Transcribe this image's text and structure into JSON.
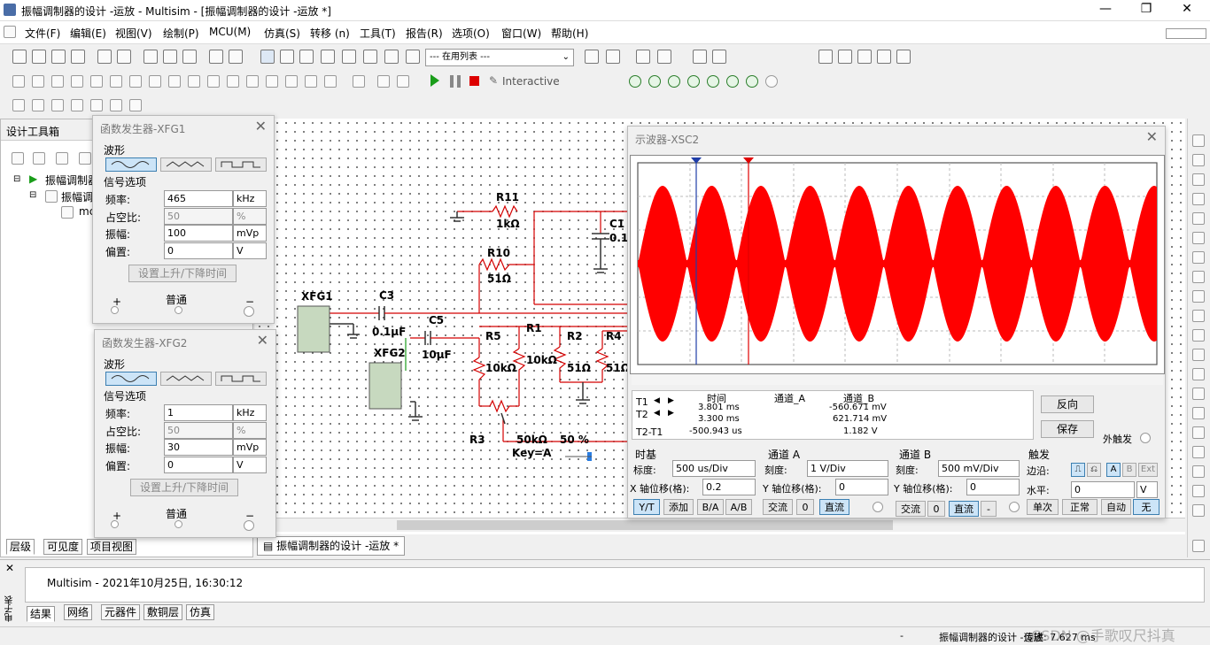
{
  "window": {
    "title": "振幅调制器的设计 -运放 - Multisim - [振幅调制器的设计 -运放 *]",
    "min": "—",
    "max": "❐",
    "close": "✕"
  },
  "menu": [
    "文件(F)",
    "编辑(E)",
    "视图(V)",
    "绘制(P)",
    "MCU(M)",
    "仿真(S)",
    "转移 (n)",
    "工具(T)",
    "报告(R)",
    "选项(O)",
    "窗口(W)",
    "帮助(H)"
  ],
  "toolbar": {
    "in_use_list": "--- 在用列表 ---",
    "interactive": "Interactive"
  },
  "design_toolbox": {
    "title": "设计工具箱",
    "tree": [
      "振幅调制器",
      "振幅调",
      "mc"
    ],
    "tabs": [
      "层级",
      "可见度",
      "项目视图"
    ]
  },
  "xfg1": {
    "title": "函数发生器-XFG1",
    "waveform_label": "波形",
    "signal_label": "信号选项",
    "freq_label": "频率:",
    "freq": "465",
    "freq_unit": "kHz",
    "duty_label": "占空比:",
    "duty": "50",
    "duty_unit": "%",
    "amp_label": "振幅:",
    "amp": "100",
    "amp_unit": "mVp",
    "offset_label": "偏置:",
    "offset": "0",
    "offset_unit": "V",
    "rise_btn": "设置上升/下降时间",
    "plus": "+",
    "common": "普通",
    "minus": "−"
  },
  "xfg2": {
    "title": "函数发生器-XFG2",
    "waveform_label": "波形",
    "signal_label": "信号选项",
    "freq_label": "频率:",
    "freq": "1",
    "freq_unit": "kHz",
    "duty_label": "占空比:",
    "duty": "50",
    "duty_unit": "%",
    "amp_label": "振幅:",
    "amp": "30",
    "amp_unit": "mVp",
    "offset_label": "偏置:",
    "offset": "0",
    "offset_unit": "V",
    "rise_btn": "设置上升/下降时间",
    "plus": "+",
    "common": "普通",
    "minus": "−"
  },
  "schematic": {
    "labels": [
      "R11",
      "1kΩ",
      "C1",
      "0.1",
      "R10",
      "51Ω",
      "XFG1",
      "C3",
      "0.1µF",
      "C5",
      "10µF",
      "XFG2",
      "R5",
      "10kΩ",
      "R1",
      "10kΩ",
      "R2",
      "51Ω",
      "R4",
      "51Ω",
      "R3",
      "50kΩ",
      "50 %",
      "Key=A"
    ],
    "doc_tab": "振幅调制器的设计 -运放 *"
  },
  "scope": {
    "title": "示波器-XSC2",
    "readout_headers": [
      "时间",
      "通道_A",
      "通道_B"
    ],
    "t1_label": "T1",
    "t2_label": "T2",
    "dt_label": "T2-T1",
    "t1": [
      "3.801 ms",
      "",
      "-560.671 mV"
    ],
    "t2": [
      "3.300 ms",
      "",
      "621.714 mV"
    ],
    "dt": [
      "-500.943 us",
      "",
      "1.182 V"
    ],
    "reverse_btn": "反向",
    "save_btn": "保存",
    "ext_trigger": "外触发",
    "timebase": {
      "title": "时基",
      "scale_label": "标度:",
      "scale": "500 us/Div",
      "xpos_label": "X 轴位移(格):",
      "xpos": "0.2",
      "buttons": [
        "Y/T",
        "添加",
        "B/A",
        "A/B"
      ]
    },
    "chA": {
      "title": "通道 A",
      "scale_label": "刻度:",
      "scale": "1 V/Div",
      "ypos_label": "Y 轴位移(格):",
      "ypos": "0",
      "buttons": [
        "交流",
        "0",
        "直流"
      ]
    },
    "chB": {
      "title": "通道 B",
      "scale_label": "刻度:",
      "scale": "500 mV/Div",
      "ypos_label": "Y 轴位移(格):",
      "ypos": "0",
      "buttons": [
        "交流",
        "0",
        "直流",
        "-"
      ]
    },
    "trigger": {
      "title": "触发",
      "edge_label": "边沿:",
      "level_label": "水平:",
      "level": "0",
      "level_unit": "V",
      "src": [
        "A",
        "B",
        "Ext"
      ],
      "buttons": [
        "单次",
        "正常",
        "自动",
        "无"
      ]
    },
    "trace_color": "#ff0000"
  },
  "bottom": {
    "side_label": "电子表",
    "message": "Multisim  -  2021年10月25日, 16:30:12",
    "tabs": [
      "结果",
      "网络",
      "元器件",
      "敷铜层",
      "仿真"
    ]
  },
  "status": {
    "dash": "-",
    "doc": "振幅调制器的设计 -运放",
    "sim": "传递: 7.627 ms",
    "watermark": "CSDN @手歌叹尺抖真"
  }
}
